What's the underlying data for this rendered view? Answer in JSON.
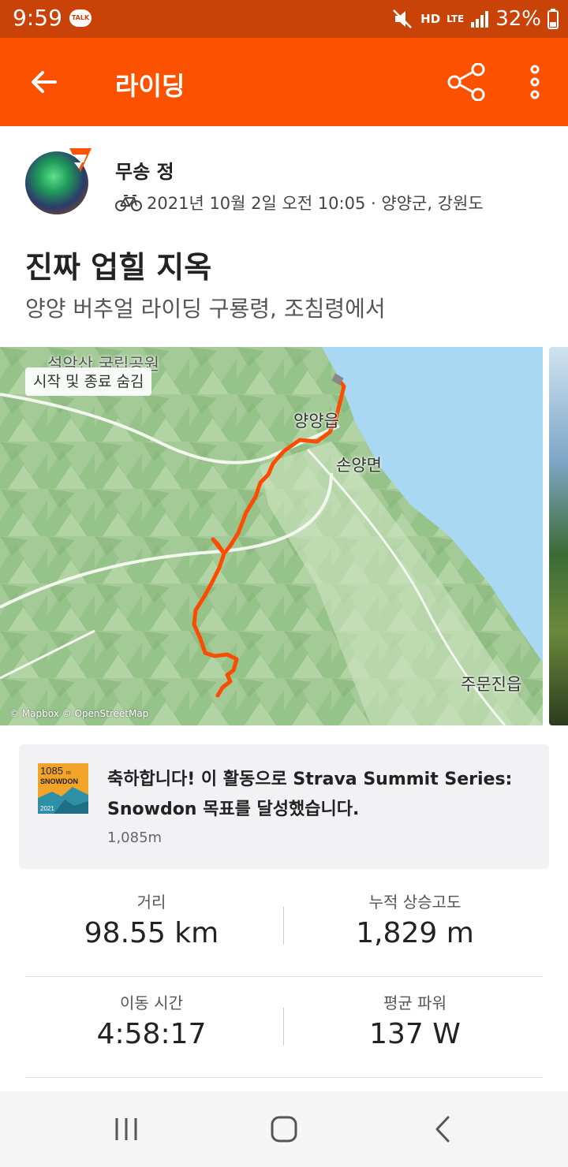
{
  "status_bar": {
    "time": "9:59",
    "talk_badge": "TALK",
    "battery_pct": "32%",
    "network": "LTE",
    "hd": "HD"
  },
  "app_bar": {
    "title": "라이딩",
    "back_icon": "arrow-left-icon",
    "share_icon": "share-icon",
    "more_icon": "more-vertical-icon"
  },
  "athlete": {
    "name": "무송 정",
    "meta": "2021년 10월 2일 오전 10:05 · 양양군, 강원도",
    "sport_icon": "bike-icon"
  },
  "activity": {
    "title": "진짜 업힐 지옥",
    "description": "양양 버추얼 라이딩 구룡령, 조침령에서"
  },
  "map": {
    "toggle_chip": "시작 및 종료 숨김",
    "labels": {
      "park": "설악산 국립공원",
      "town1": "양양읍",
      "town2": "손양면",
      "town3": "주문진읍"
    },
    "attribution": "© Mapbox © OpenStreetMap",
    "route_color": "#fc4c02",
    "sea_color": "#a9d8f2"
  },
  "achievement": {
    "text": "축하합니다! 이 활동으로 Strava Summit Series: Snowdon 목표를 달성했습니다.",
    "sub": "1,085m",
    "badge": {
      "elevation": "1085",
      "unit": "m",
      "name": "SNOWDON",
      "year": "2021"
    }
  },
  "stats": [
    {
      "label": "거리",
      "value": "98.55 km"
    },
    {
      "label": "누적 상승고도",
      "value": "1,829 m"
    },
    {
      "label": "이동 시간",
      "value": "4:58:17"
    },
    {
      "label": "평균 파워",
      "value": "137 W"
    }
  ],
  "nav": {
    "recents_icon": "recents-icon",
    "home_icon": "home-icon",
    "back_icon": "back-chevron-icon"
  },
  "colors": {
    "accent": "#fc5200",
    "status_bar": "#c94308"
  }
}
